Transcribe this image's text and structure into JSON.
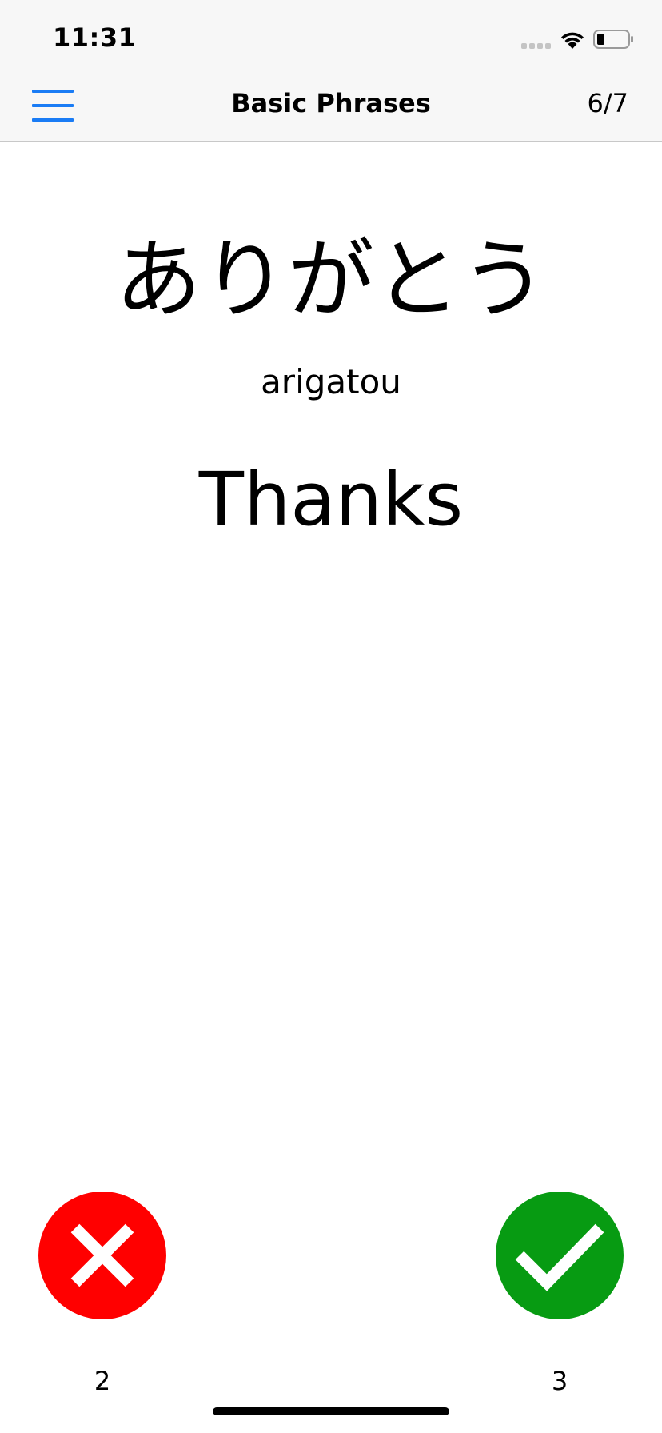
{
  "status_bar": {
    "time": "11:31",
    "icons": [
      "signal-icon",
      "wifi-icon",
      "battery-icon"
    ]
  },
  "nav": {
    "title": "Basic Phrases",
    "counter": "6/7",
    "menu_icon": "hamburger-menu-icon"
  },
  "card": {
    "japanese": "ありがとう",
    "romaji": "arigatou",
    "english": "Thanks"
  },
  "answers": {
    "wrong_count": "2",
    "right_count": "3",
    "wrong_icon": "cross-icon",
    "right_icon": "checkmark-icon"
  },
  "colors": {
    "accent": "#1a7cf5",
    "wrong": "#ff0000",
    "right": "#079b12",
    "bar_background": "#f7f7f7"
  }
}
